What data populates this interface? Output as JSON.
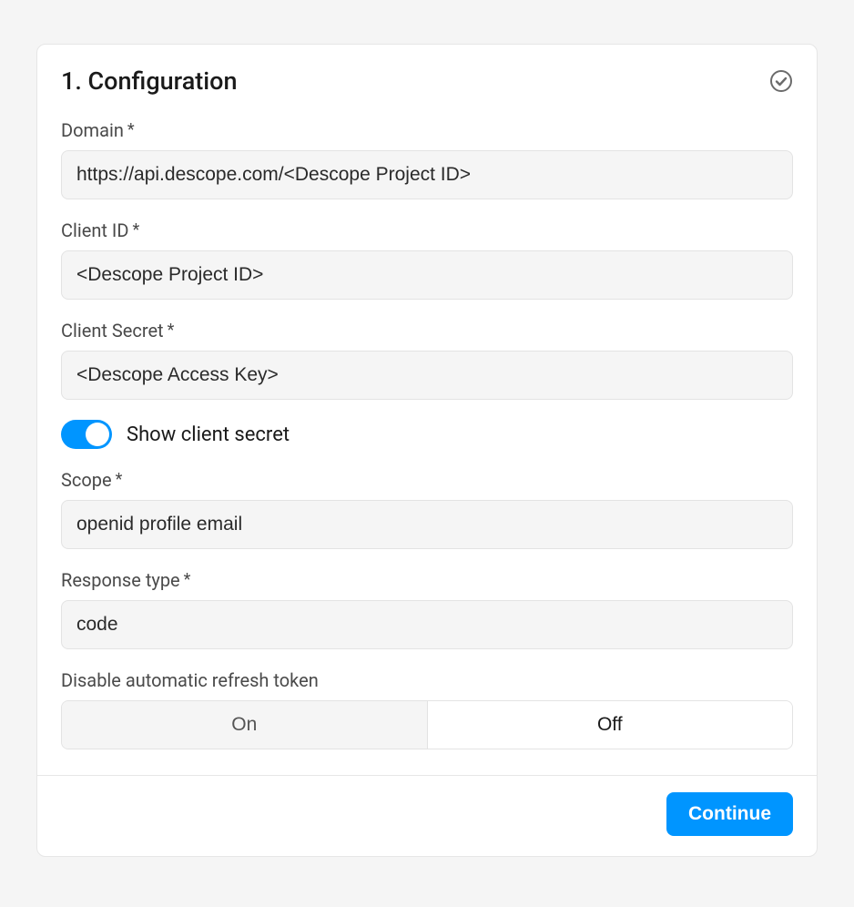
{
  "card": {
    "title": "1. Configuration",
    "status_complete": true
  },
  "fields": {
    "domain": {
      "label": "Domain",
      "value": "https://api.descope.com/<Descope Project ID>"
    },
    "client_id": {
      "label": "Client ID",
      "value": "<Descope Project ID>"
    },
    "client_secret": {
      "label": "Client Secret",
      "value": "<Descope Access Key>"
    },
    "scope": {
      "label": "Scope",
      "value": "openid profile email"
    },
    "response_type": {
      "label": "Response type",
      "value": "code"
    }
  },
  "toggle": {
    "show_secret_label": "Show client secret",
    "show_secret_on": true
  },
  "refresh_token": {
    "label": "Disable automatic refresh token",
    "option_on": "On",
    "option_off": "Off",
    "selected": "Off"
  },
  "actions": {
    "continue_label": "Continue"
  }
}
